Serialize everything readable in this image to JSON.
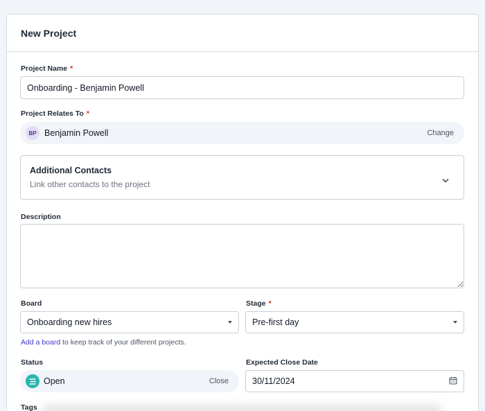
{
  "form": {
    "title": "New Project",
    "project_name": {
      "label": "Project Name",
      "required": "*",
      "value": "Onboarding - Benjamin Powell"
    },
    "relates_to": {
      "label": "Project Relates To",
      "required": "*",
      "avatar_initials": "BP",
      "contact_name": "Benjamin Powell",
      "change_label": "Change"
    },
    "additional_contacts": {
      "title": "Additional Contacts",
      "subtitle": "Link other contacts to the project",
      "icon": "chevron-down-icon"
    },
    "description": {
      "label": "Description",
      "value": ""
    },
    "board": {
      "label": "Board",
      "value": "Onboarding new hires",
      "hint_link": "Add a board",
      "hint_text": " to keep track of your different projects."
    },
    "stage": {
      "label": "Stage",
      "required": "*",
      "value": "Pre-first day"
    },
    "status": {
      "label": "Status",
      "value": "Open",
      "close_label": "Close",
      "icon": "status-list-icon",
      "color": "#2bb5ad"
    },
    "expected_close": {
      "label": "Expected Close Date",
      "value": "30/11/2024",
      "icon": "calendar-icon"
    },
    "tags": {
      "label": "Tags"
    }
  }
}
